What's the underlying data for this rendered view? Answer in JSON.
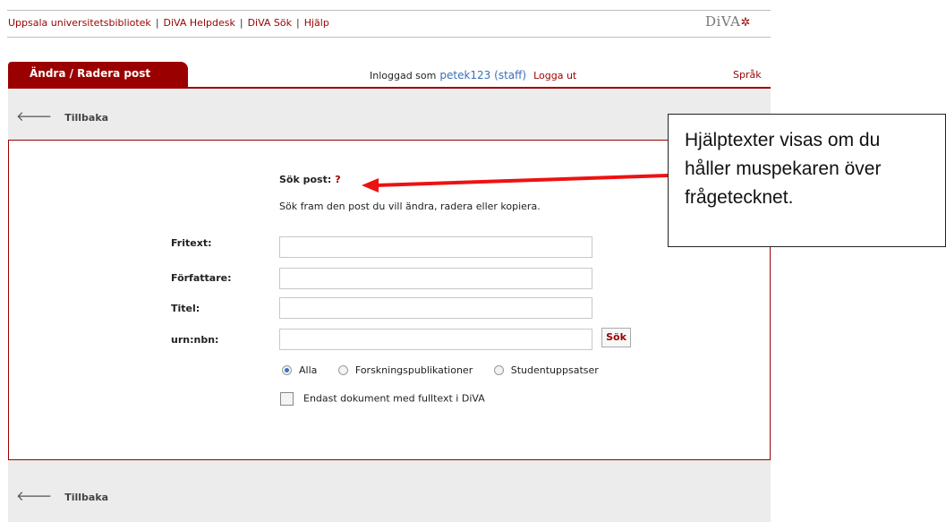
{
  "header": {
    "links": [
      "Uppsala universitetsbibliotek",
      "DiVA Helpdesk",
      "DiVA Sök",
      "Hjälp"
    ],
    "separator": "|",
    "logo_text": "DiVA"
  },
  "tab": {
    "label": "Ändra / Radera post"
  },
  "login": {
    "prefix": "Inloggad som",
    "user": "petek123 (staff)",
    "logout": "Logga ut"
  },
  "language_link": "Språk",
  "back_label": "Tillbaka",
  "form": {
    "title": "Sök post:",
    "help_mark": "?",
    "intro": "Sök fram den post du vill ändra, radera eller kopiera.",
    "fields": [
      {
        "label": "Fritext:",
        "value": ""
      },
      {
        "label": "Författare:",
        "value": ""
      },
      {
        "label": "Titel:",
        "value": ""
      },
      {
        "label": "urn:nbn:",
        "value": ""
      }
    ],
    "search_button": "Sök",
    "radio_options": [
      "Alla",
      "Forskningspublikationer",
      "Studentuppsatser"
    ],
    "radio_selected": "Alla",
    "checkbox_label": "Endast dokument med fulltext i DiVA",
    "checkbox_checked": false
  },
  "callout": {
    "lines": [
      "Hjälptexter visas om du",
      "håller muspekaren över",
      "frågetecknet."
    ]
  },
  "colors": {
    "accent": "#9b0000",
    "link_blue": "#3b70b5",
    "annotation_arrow": "#ee1111"
  }
}
